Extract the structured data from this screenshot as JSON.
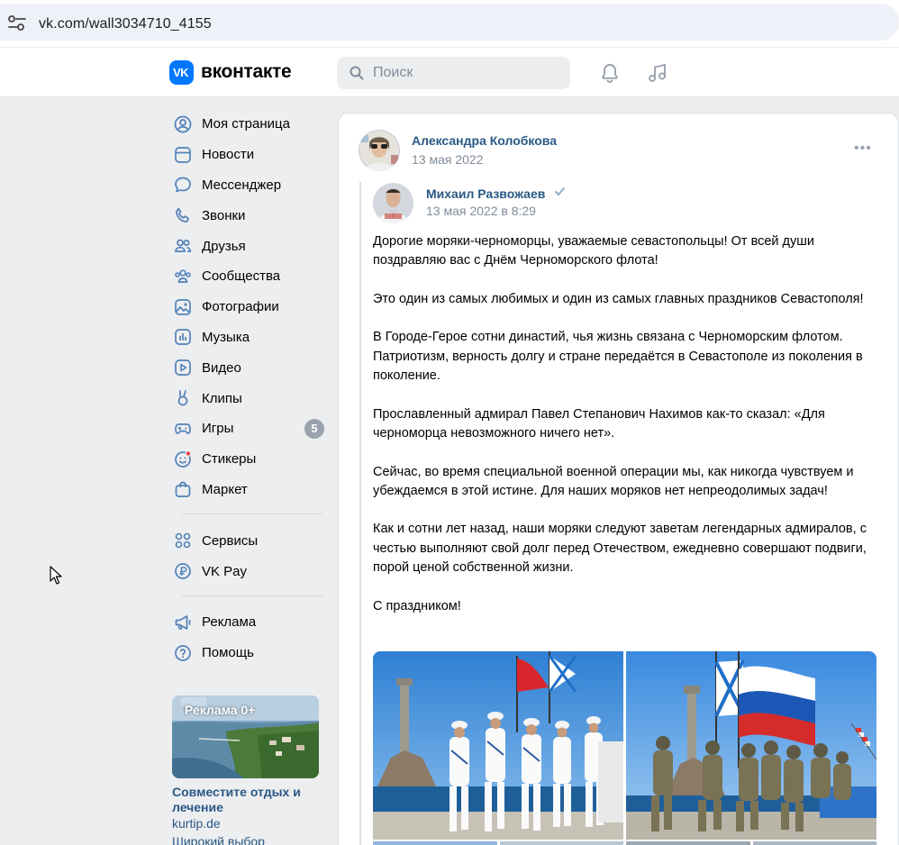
{
  "browser": {
    "url": "vk.com/wall3034710_4155"
  },
  "header": {
    "logo_text": "VK",
    "brand": "вконтакте",
    "search_placeholder": "Поиск"
  },
  "sidebar": {
    "items": [
      {
        "label": "Моя страница",
        "icon": "user-circle-icon"
      },
      {
        "label": "Новости",
        "icon": "news-icon"
      },
      {
        "label": "Мессенджер",
        "icon": "message-icon"
      },
      {
        "label": "Звонки",
        "icon": "phone-icon"
      },
      {
        "label": "Друзья",
        "icon": "friends-icon"
      },
      {
        "label": "Сообщества",
        "icon": "communities-icon"
      },
      {
        "label": "Фотографии",
        "icon": "photo-icon"
      },
      {
        "label": "Музыка",
        "icon": "music-icon"
      },
      {
        "label": "Видео",
        "icon": "video-icon"
      },
      {
        "label": "Клипы",
        "icon": "clips-icon"
      },
      {
        "label": "Игры",
        "icon": "gamepad-icon",
        "badge": "5"
      },
      {
        "label": "Стикеры",
        "icon": "sticker-icon"
      },
      {
        "label": "Маркет",
        "icon": "market-bag-icon"
      }
    ],
    "services": [
      {
        "label": "Сервисы",
        "icon": "services-grid-icon"
      },
      {
        "label": "VK Pay",
        "icon": "vkpay-icon"
      }
    ],
    "extra": [
      {
        "label": "Реклама",
        "icon": "megaphone-icon"
      },
      {
        "label": "Помощь",
        "icon": "help-icon"
      }
    ],
    "ad": {
      "label": "Реклама 0+",
      "title": "Совместите отдых и лечение",
      "site": "kurtip.de",
      "desc": "Широкий выбор"
    }
  },
  "post": {
    "author": "Александра Колобкова",
    "date": "13 мая 2022",
    "more": "•••",
    "repost": {
      "author": "Михаил Развожаев",
      "date": "13 мая 2022 в 8:29",
      "paragraphs": [
        "Дорогие моряки-черноморцы, уважаемые севастопольцы! От всей души поздравляю вас с Днём Черноморского флота!",
        "Это один из самых любимых и один из самых главных праздников Севастополя!",
        "В Городе-Герое сотни династий, чья жизнь связана с Черноморским флотом. Патриотизм, верность долгу и стране передаётся в Севастополе из поколения в поколение.",
        "Прославленный адмирал Павел Степанович Нахимов как-то сказал: «Для черноморца невозможного ничего нет».",
        "Сейчас, во время специальной военной операции мы, как никогда чувствуем и убеждаемся в этой истине. Для наших моряков нет непреодолимых задач!",
        "Как и сотни лет назад, наши моряки следуют заветам легендарных адмиралов, с честью выполняют свой долг перед Отечеством, ежедневно совершают подвиги, порой ценой собственной жизни.",
        "С праздником!"
      ]
    }
  }
}
